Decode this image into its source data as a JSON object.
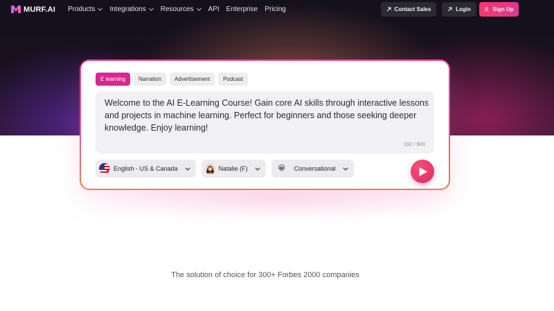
{
  "nav": {
    "logo_text": "MURF.AI",
    "links": [
      {
        "label": "Products",
        "has_dropdown": true
      },
      {
        "label": "Integrations",
        "has_dropdown": true
      },
      {
        "label": "Resources",
        "has_dropdown": true
      },
      {
        "label": "API",
        "has_dropdown": false
      },
      {
        "label": "Enterprise",
        "has_dropdown": false
      },
      {
        "label": "Pricing",
        "has_dropdown": false
      }
    ],
    "contact_label": "Contact Sales",
    "login_label": "Login",
    "signup_label": "Sign Up"
  },
  "card": {
    "tabs": [
      {
        "label": "E learning",
        "active": true
      },
      {
        "label": "Narration",
        "active": false
      },
      {
        "label": "Advertisement",
        "active": false
      },
      {
        "label": "Podcast",
        "active": false
      }
    ],
    "text": "Welcome to the AI E-Learning Course! Gain core AI skills through interactive lessons and projects in machine learning. Perfect for beginners and those seeking deeper knowledge. Enjoy learning!",
    "char_count": "192 / 500",
    "language": "English - US & Canada",
    "voice": "Natalie (F)",
    "style_emoji": "😀",
    "style": "Conversational"
  },
  "tagline": "The solution of choice for 300+ Forbes 2000 companies",
  "colors": {
    "accent_pink": "#d6288f",
    "signup_gradient_start": "#f0386d",
    "play_red": "#e02a62"
  },
  "icons": {
    "logo": "murf-logo-icon",
    "dropdown": "chevron-down-icon",
    "external": "arrow-up-right-icon",
    "user": "user-icon",
    "play": "play-icon",
    "flag": "us-flag-icon",
    "avatar": "voice-avatar"
  }
}
